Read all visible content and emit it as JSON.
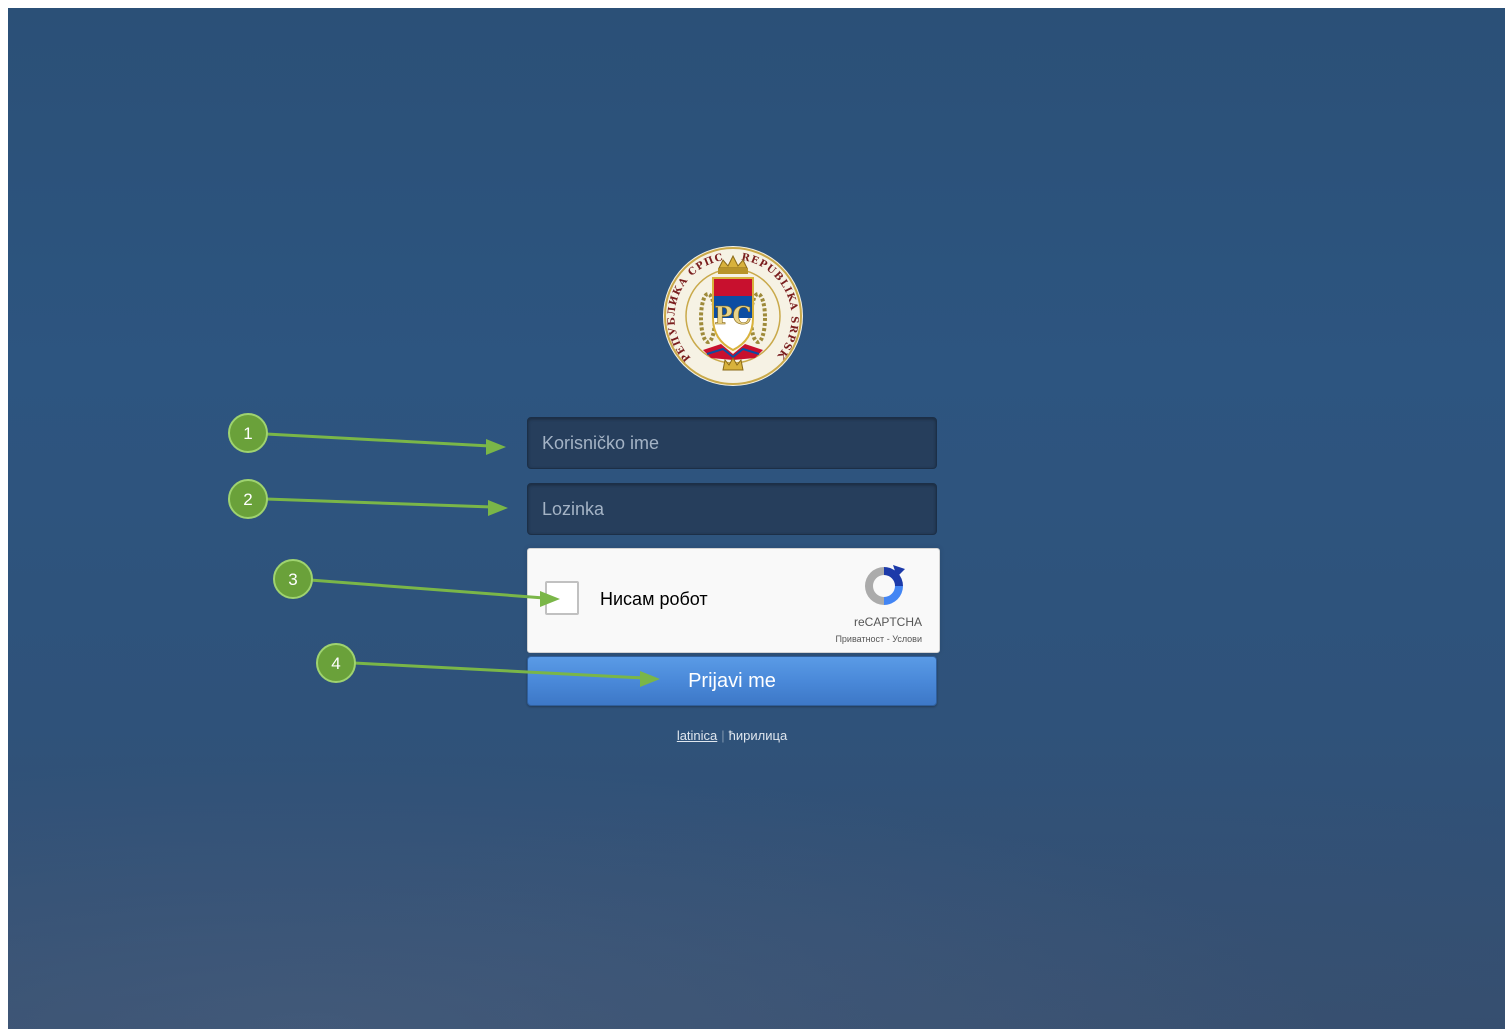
{
  "logo": {
    "ring_text_left": "РЕПУБЛИКА СРПСКА",
    "ring_text_right": "REPUBLIKA SRPSKA",
    "monogram": "РС"
  },
  "form": {
    "username_placeholder": "Korisničko ime",
    "password_placeholder": "Lozinka"
  },
  "captcha": {
    "label": "Нисам робот",
    "brand": "reCAPTCHA",
    "privacy": "Приватност",
    "separator": "-",
    "terms": "Услови"
  },
  "login_button": "Prijavi me",
  "language": {
    "latin": "latinica",
    "separator": "|",
    "cyrillic": "ћирилица"
  },
  "annotations": {
    "labels": [
      "1",
      "2",
      "3",
      "4"
    ],
    "color": "#7ab648"
  },
  "colors": {
    "background": "#2d5580",
    "field": "#263e5c",
    "button": "#4a89d9"
  }
}
